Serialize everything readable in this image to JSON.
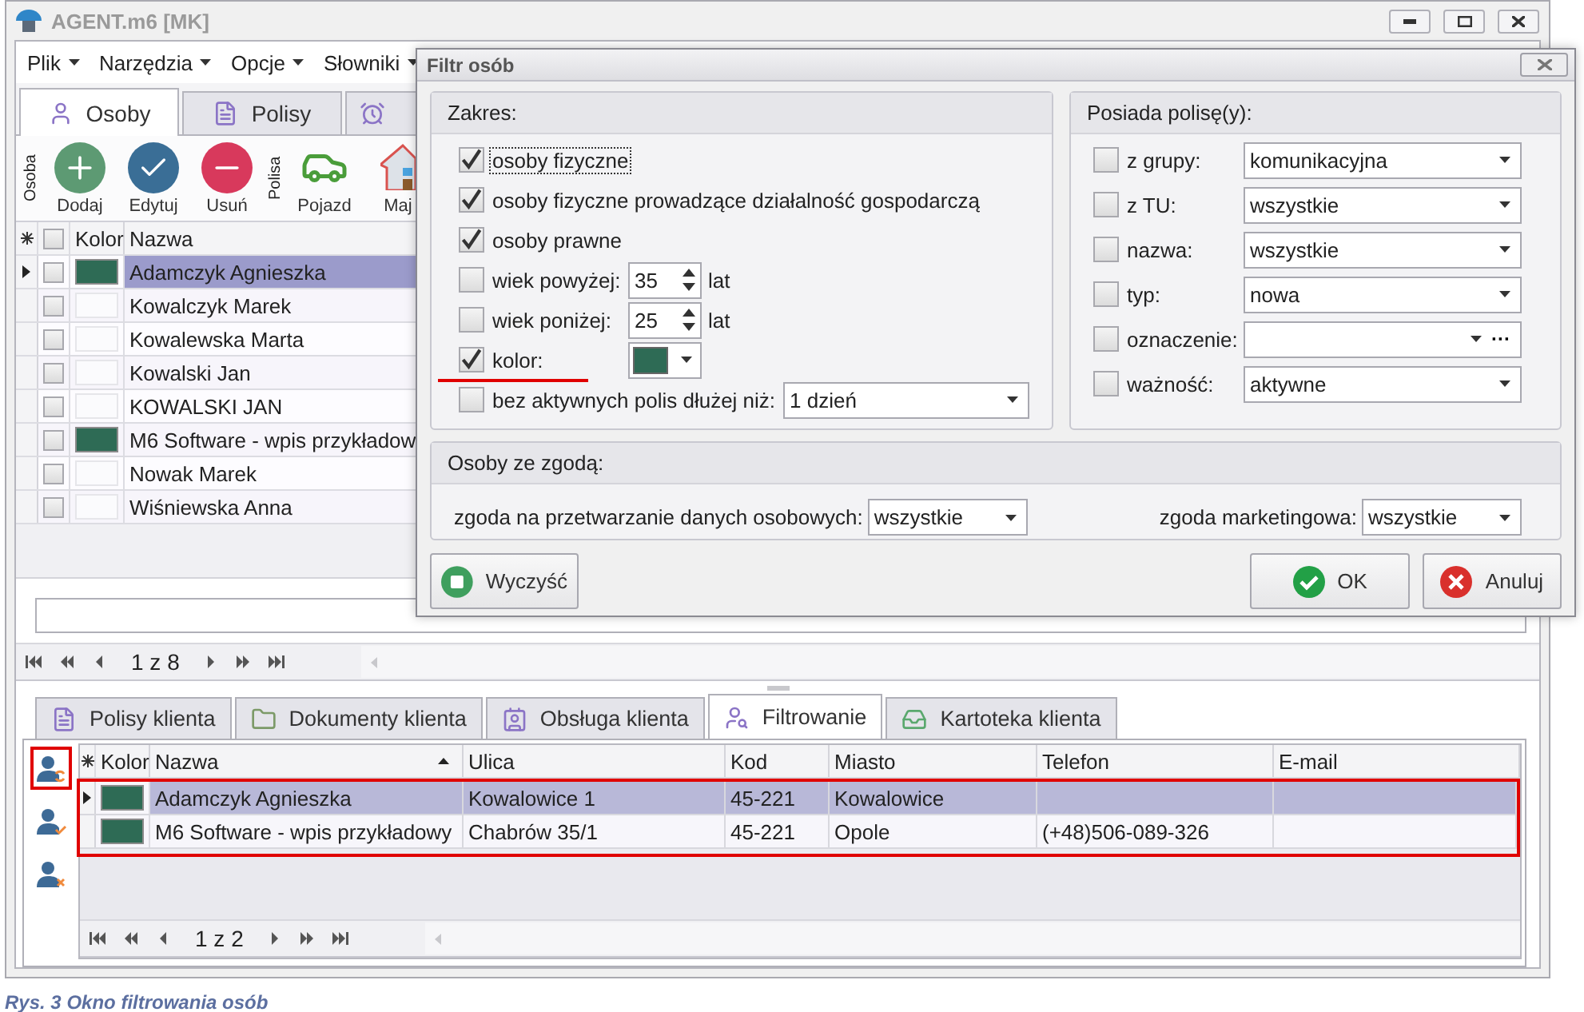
{
  "window": {
    "title": "AGENT.m6 [MK]"
  },
  "menu": [
    {
      "label": "Plik"
    },
    {
      "label": "Narzędzia"
    },
    {
      "label": "Opcje"
    },
    {
      "label": "Słowniki"
    }
  ],
  "main_tabs": [
    {
      "label": "Osoby",
      "kind": "person",
      "selected": true
    },
    {
      "label": "Polisy",
      "kind": "document",
      "selected": false
    },
    {
      "kind": "alarm",
      "selected": false
    }
  ],
  "toolbar": [
    {
      "label": "Osoba",
      "buttons": [
        {
          "label": "Dodaj",
          "kind": "add"
        },
        {
          "label": "Edytuj",
          "kind": "edit"
        },
        {
          "label": "Usuń",
          "kind": "delete"
        }
      ]
    },
    {
      "label": "Polisa",
      "buttons": [
        {
          "label": "Pojazd",
          "kind": "car"
        },
        {
          "label": "Maj",
          "kind": "house"
        }
      ]
    }
  ],
  "persons_grid": {
    "header_checked": false,
    "color_column": "Kolor",
    "name_column": "Nazwa",
    "rows": [
      {
        "name": "Adamczyk Agnieszka",
        "color": "#2e6b55",
        "selected": true,
        "checked": false
      },
      {
        "name": "Kowalczyk Marek",
        "selected": false,
        "checked": false
      },
      {
        "name": "Kowalewska Marta",
        "selected": false,
        "checked": false
      },
      {
        "name": "Kowalski Jan",
        "selected": false,
        "checked": false
      },
      {
        "name": "KOWALSKI JAN",
        "selected": false,
        "checked": false
      },
      {
        "name": "M6 Software - wpis przykładow",
        "color": "#2e6b55",
        "selected": false,
        "checked": false
      },
      {
        "name": "Nowak  Marek",
        "selected": false,
        "checked": false
      },
      {
        "name": "Wiśniewska Anna",
        "selected": false,
        "checked": false
      }
    ]
  },
  "pager": "1 z 8",
  "detail_tabs": [
    {
      "label": "Polisy klienta",
      "kind": "document",
      "selected": false
    },
    {
      "label": "Dokumenty klienta",
      "kind": "folder",
      "selected": false
    },
    {
      "label": "Obsługa klienta",
      "kind": "contact",
      "selected": false
    },
    {
      "label": "Filtrowanie",
      "kind": "user-search",
      "selected": true
    },
    {
      "label": "Kartoteka klienta",
      "kind": "inbox",
      "selected": false
    }
  ],
  "filter_actions": [
    {
      "kind": "refresh",
      "highlighted": true
    },
    {
      "kind": "apply",
      "highlighted": false
    },
    {
      "kind": "clear",
      "highlighted": false
    }
  ],
  "results_grid": {
    "highlighted": true,
    "color_column": "Kolor",
    "columns": [
      {
        "label": "Nazwa",
        "sorted": true
      },
      {
        "label": "Ulica",
        "sorted": false
      },
      {
        "label": "Kod",
        "sorted": false
      },
      {
        "label": "Miasto",
        "sorted": false
      },
      {
        "label": "Telefon",
        "sorted": false
      },
      {
        "label": "E-mail",
        "sorted": false
      }
    ],
    "rows": [
      {
        "color": "#2e6b55",
        "cells": [
          "Adamczyk Agnieszka",
          "Kowalowice 1",
          "45-221",
          "Kowalowice"
        ],
        "selected": true
      },
      {
        "color": "#2e6b55",
        "cells": [
          "M6 Software - wpis przykładowy",
          "Chabrów 35/1",
          "45-221",
          "Opole",
          "(+48)506-089-326"
        ],
        "selected": false
      }
    ]
  },
  "results_pager": "1 z 2",
  "dialog": {
    "title": "Filtr osób",
    "scope": {
      "title": "Zakres:",
      "items": [
        {
          "kind": "check",
          "label": "osoby fizyczne",
          "checked": true,
          "focused": true
        },
        {
          "kind": "check",
          "label": "osoby fizyczne prowadzące działalność gospodarczą",
          "checked": true,
          "focused": false
        },
        {
          "kind": "check",
          "label": "osoby prawne",
          "checked": true,
          "focused": false
        },
        {
          "kind": "spin",
          "label": "wiek powyżej:",
          "checked": false,
          "value": "35",
          "unit": "lat"
        },
        {
          "kind": "spin",
          "label": "wiek poniżej:",
          "checked": false,
          "value": "25",
          "unit": "lat"
        },
        {
          "kind": "color",
          "label": "kolor:",
          "checked": true,
          "color": "#2e6b55",
          "underlined": true
        },
        {
          "kind": "combo",
          "label": "bez aktywnych polis dłużej niż:",
          "checked": false,
          "value": "1 dzień"
        }
      ]
    },
    "policy": {
      "title": "Posiada polisę(y):",
      "items": [
        {
          "label": "z grupy:",
          "checked": false,
          "value": "komunikacyjna"
        },
        {
          "label": "z TU:",
          "checked": false,
          "value": "wszystkie"
        },
        {
          "label": "nazwa:",
          "checked": false,
          "value": "wszystkie"
        },
        {
          "label": "typ:",
          "checked": false,
          "value": "nowa"
        },
        {
          "label": "oznaczenie:",
          "checked": false,
          "extra": "···"
        },
        {
          "label": "ważność:",
          "checked": false,
          "value": "aktywne"
        }
      ]
    },
    "consent": {
      "title": "Osoby ze zgodą:",
      "items": [
        {
          "label": "zgoda na przetwarzanie danych osobowych:",
          "value": "wszystkie"
        },
        {
          "label": "zgoda marketingowa:",
          "value": "wszystkie"
        }
      ]
    },
    "buttons": [
      {
        "label": "Wyczyść",
        "kind": "clear"
      },
      {
        "label": "OK",
        "kind": "ok"
      },
      {
        "label": "Anuluj",
        "kind": "cancel"
      }
    ]
  },
  "caption": "Rys. 3 Okno filtrowania osób"
}
